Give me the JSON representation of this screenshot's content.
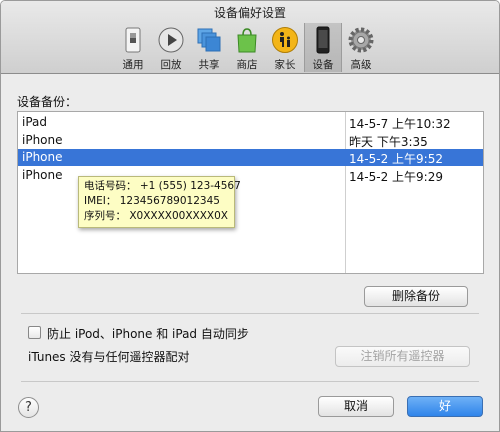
{
  "window": {
    "title": "设备偏好设置"
  },
  "toolbar": {
    "items": [
      {
        "label": "通用",
        "icon": "general-switch-icon"
      },
      {
        "label": "回放",
        "icon": "playback-icon"
      },
      {
        "label": "共享",
        "icon": "sharing-icon"
      },
      {
        "label": "商店",
        "icon": "store-bag-icon"
      },
      {
        "label": "家长",
        "icon": "parental-icon"
      },
      {
        "label": "设备",
        "icon": "device-iphone-icon"
      },
      {
        "label": "高级",
        "icon": "advanced-gear-icon"
      }
    ],
    "active": "设备"
  },
  "backups": {
    "label": "设备备份：",
    "rows": [
      {
        "name": "iPad",
        "date": "14-5-7 上午10:32"
      },
      {
        "name": "iPhone",
        "date": "昨天 下午3:35"
      },
      {
        "name": "iPhone",
        "date": "14-5-2 上午9:52"
      },
      {
        "name": "iPhone",
        "date": "14-5-2 上午9:29"
      }
    ],
    "selected_index": 2,
    "delete_button": "删除备份"
  },
  "tooltip": {
    "phone": "电话号码：  +1 (555) 123-4567",
    "imei": "IMEI：  123456789012345",
    "serial": "序列号：  X0XXXX00XXXX0X"
  },
  "options": {
    "prevent_sync_label": "防止 iPod、iPhone 和 iPad 自动同步",
    "prevent_sync_checked": false,
    "remote_status": "iTunes 没有与任何遥控器配对",
    "unregister_button": "注销所有遥控器"
  },
  "footer": {
    "help": "?",
    "cancel": "取消",
    "ok": "好"
  },
  "colors": {
    "selection": "#3875d7",
    "tooltip_bg": "#fdfdc4",
    "primary_button": "#2f84ea"
  }
}
